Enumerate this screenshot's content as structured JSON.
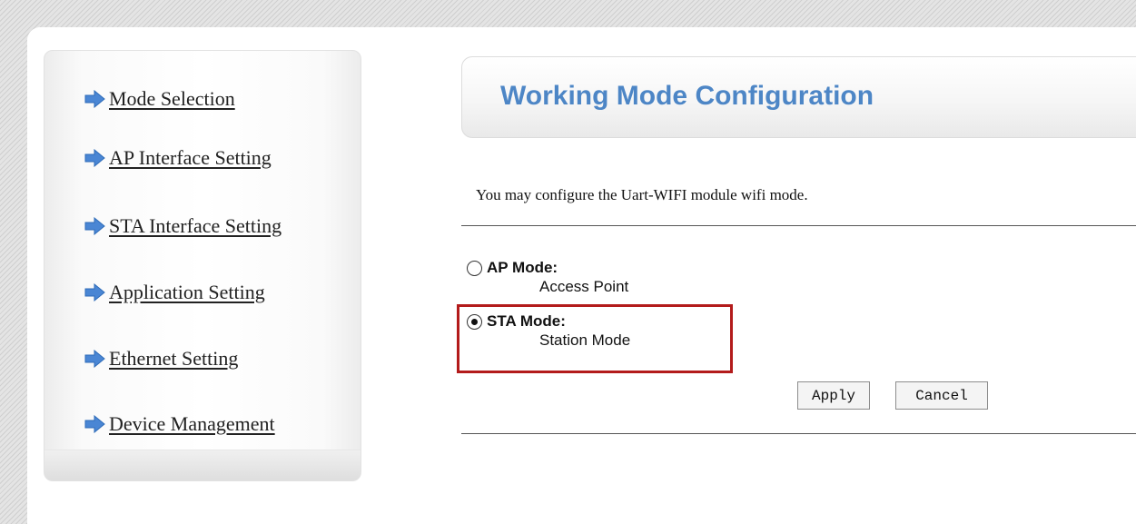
{
  "sidebar": {
    "items": [
      {
        "label": "Mode Selection"
      },
      {
        "label": "AP Interface Setting"
      },
      {
        "label": "STA Interface Setting"
      },
      {
        "label": "Application Setting"
      },
      {
        "label": "Ethernet Setting"
      },
      {
        "label": "Device Management"
      }
    ],
    "icon": "arrow-right-icon"
  },
  "header": {
    "title": "Working Mode Configuration"
  },
  "main": {
    "description": "You may configure the Uart-WIFI module wifi mode.",
    "modes": [
      {
        "label": "AP Mode:",
        "sublabel": "Access Point",
        "selected": false
      },
      {
        "label": "STA Mode:",
        "sublabel": "Station Mode",
        "selected": true
      }
    ],
    "apply_label": "Apply",
    "cancel_label": "Cancel"
  },
  "colors": {
    "title": "#4d86c6",
    "arrow": "#4a86d4",
    "highlight": "#b31b1b"
  }
}
